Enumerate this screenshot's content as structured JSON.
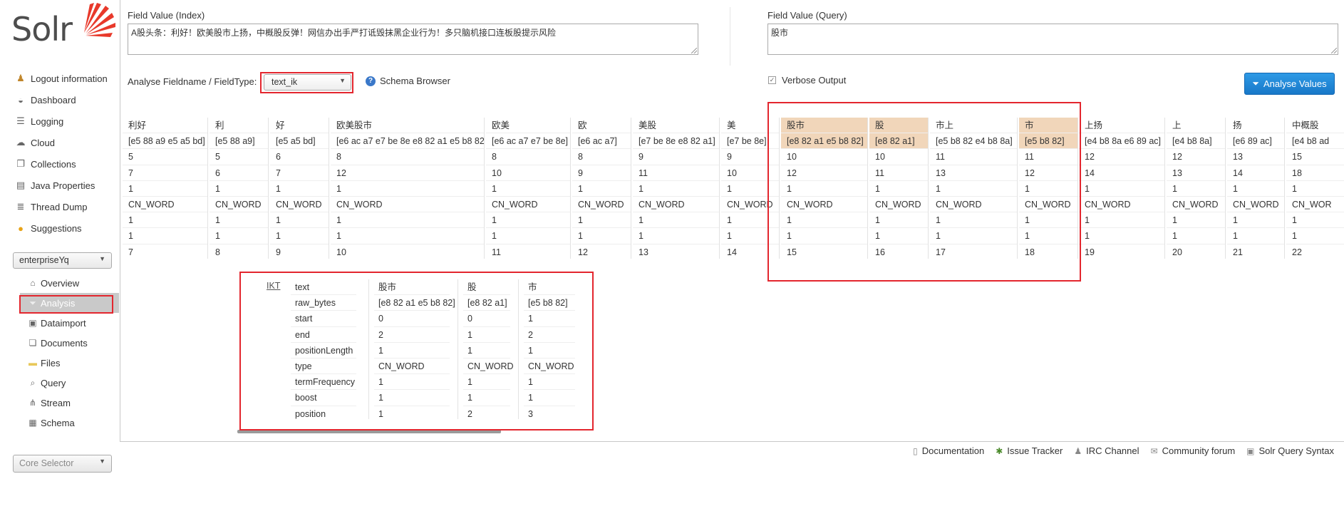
{
  "app": {
    "logo_text": "Solr"
  },
  "sidebar": {
    "items": [
      {
        "label": "Logout information",
        "icon": "user-key-icon"
      },
      {
        "label": "Dashboard",
        "icon": "dashboard-icon"
      },
      {
        "label": "Logging",
        "icon": "logging-icon"
      },
      {
        "label": "Cloud",
        "icon": "cloud-icon"
      },
      {
        "label": "Collections",
        "icon": "collections-icon"
      },
      {
        "label": "Java Properties",
        "icon": "java-properties-icon"
      },
      {
        "label": "Thread Dump",
        "icon": "thread-dump-icon"
      },
      {
        "label": "Suggestions",
        "icon": "lightbulb-icon"
      }
    ],
    "core_dropdown": "enterpriseYq",
    "core_items": [
      {
        "label": "Overview",
        "icon": "home-icon"
      },
      {
        "label": "Analysis",
        "icon": "filter-icon"
      },
      {
        "label": "Dataimport",
        "icon": "dataimport-icon"
      },
      {
        "label": "Documents",
        "icon": "documents-icon"
      },
      {
        "label": "Files",
        "icon": "folder-icon"
      },
      {
        "label": "Query",
        "icon": "search-icon"
      },
      {
        "label": "Stream",
        "icon": "stream-icon"
      },
      {
        "label": "Schema",
        "icon": "schema-icon"
      }
    ],
    "core_selector": "Core Selector"
  },
  "analysis": {
    "index_label": "Field Value (Index)",
    "index_value": "A股头条：利好！欧美股市上扬，中概股反弹！网信办出手严打诋毁抹黑企业行为！多只脑机接口连板股提示风险",
    "query_label": "Field Value (Query)",
    "query_value": "股市",
    "fieldtype_label": "Analyse Fieldname / FieldType:",
    "fieldtype_value": "text_ik",
    "schema_browser": "Schema Browser",
    "verbose_label": "Verbose Output",
    "analyse_button": "Analyse Values"
  },
  "tokens": [
    {
      "text": "利好",
      "bytes": "[e5 88 a9 e5 a5 bd]",
      "start": "5",
      "end": "7",
      "posLen": "1",
      "type": "CN_WORD",
      "tf": "1",
      "boost": "1",
      "pos": "7",
      "hl": false
    },
    {
      "text": "利",
      "bytes": "[e5 88 a9]",
      "start": "5",
      "end": "6",
      "posLen": "1",
      "type": "CN_WORD",
      "tf": "1",
      "boost": "1",
      "pos": "8",
      "hl": false
    },
    {
      "text": "好",
      "bytes": "[e5 a5 bd]",
      "start": "6",
      "end": "7",
      "posLen": "1",
      "type": "CN_WORD",
      "tf": "1",
      "boost": "1",
      "pos": "9",
      "hl": false
    },
    {
      "text": "欧美股市",
      "bytes": "[e6 ac a7 e7 be 8e e8 82 a1 e5 b8 82]",
      "start": "8",
      "end": "12",
      "posLen": "1",
      "type": "CN_WORD",
      "tf": "1",
      "boost": "1",
      "pos": "10",
      "hl": false
    },
    {
      "text": "欧美",
      "bytes": "[e6 ac a7 e7 be 8e]",
      "start": "8",
      "end": "10",
      "posLen": "1",
      "type": "CN_WORD",
      "tf": "1",
      "boost": "1",
      "pos": "11",
      "hl": false
    },
    {
      "text": "欧",
      "bytes": "[e6 ac a7]",
      "start": "8",
      "end": "9",
      "posLen": "1",
      "type": "CN_WORD",
      "tf": "1",
      "boost": "1",
      "pos": "12",
      "hl": false
    },
    {
      "text": "美股",
      "bytes": "[e7 be 8e e8 82 a1]",
      "start": "9",
      "end": "11",
      "posLen": "1",
      "type": "CN_WORD",
      "tf": "1",
      "boost": "1",
      "pos": "13",
      "hl": false
    },
    {
      "text": "美",
      "bytes": "[e7 be 8e]",
      "start": "9",
      "end": "10",
      "posLen": "1",
      "type": "CN_WORD",
      "tf": "1",
      "boost": "1",
      "pos": "14",
      "hl": false
    },
    {
      "text": "股市",
      "bytes": "[e8 82 a1 e5 b8 82]",
      "start": "10",
      "end": "12",
      "posLen": "1",
      "type": "CN_WORD",
      "tf": "1",
      "boost": "1",
      "pos": "15",
      "hl": true
    },
    {
      "text": "股",
      "bytes": "[e8 82 a1]",
      "start": "10",
      "end": "11",
      "posLen": "1",
      "type": "CN_WORD",
      "tf": "1",
      "boost": "1",
      "pos": "16",
      "hl": true
    },
    {
      "text": "市上",
      "bytes": "[e5 b8 82 e4 b8 8a]",
      "start": "11",
      "end": "13",
      "posLen": "1",
      "type": "CN_WORD",
      "tf": "1",
      "boost": "1",
      "pos": "17",
      "hl": false
    },
    {
      "text": "市",
      "bytes": "[e5 b8 82]",
      "start": "11",
      "end": "12",
      "posLen": "1",
      "type": "CN_WORD",
      "tf": "1",
      "boost": "1",
      "pos": "18",
      "hl": true
    },
    {
      "text": "上扬",
      "bytes": "[e4 b8 8a e6 89 ac]",
      "start": "12",
      "end": "14",
      "posLen": "1",
      "type": "CN_WORD",
      "tf": "1",
      "boost": "1",
      "pos": "19",
      "hl": false
    },
    {
      "text": "上",
      "bytes": "[e4 b8 8a]",
      "start": "12",
      "end": "13",
      "posLen": "1",
      "type": "CN_WORD",
      "tf": "1",
      "boost": "1",
      "pos": "20",
      "hl": false
    },
    {
      "text": "扬",
      "bytes": "[e6 89 ac]",
      "start": "13",
      "end": "14",
      "posLen": "1",
      "type": "CN_WORD",
      "tf": "1",
      "boost": "1",
      "pos": "21",
      "hl": false
    },
    {
      "text": "中概股",
      "bytes": "[e4 b8 ad",
      "start": "15",
      "end": "18",
      "posLen": "1",
      "type": "CN_WOR",
      "tf": "1",
      "boost": "1",
      "pos": "22",
      "hl": false
    }
  ],
  "ikt": {
    "tag": "IKT",
    "row_labels": [
      "text",
      "raw_bytes",
      "start",
      "end",
      "positionLength",
      "type",
      "termFrequency",
      "boost",
      "position"
    ],
    "tokens": [
      {
        "values": [
          "股市",
          "[e8 82 a1 e5 b8 82]",
          "0",
          "2",
          "1",
          "CN_WORD",
          "1",
          "1",
          "1"
        ]
      },
      {
        "values": [
          "股",
          "[e8 82 a1]",
          "0",
          "1",
          "1",
          "CN_WORD",
          "1",
          "1",
          "2"
        ]
      },
      {
        "values": [
          "市",
          "[e5 b8 82]",
          "1",
          "2",
          "1",
          "CN_WORD",
          "1",
          "1",
          "3"
        ]
      }
    ]
  },
  "footer": {
    "links": [
      {
        "label": "Documentation",
        "icon": "document-icon"
      },
      {
        "label": "Issue Tracker",
        "icon": "bug-icon"
      },
      {
        "label": "IRC Channel",
        "icon": "irc-icon"
      },
      {
        "label": "Community forum",
        "icon": "mail-icon"
      },
      {
        "label": "Solr Query Syntax",
        "icon": "query-syntax-icon"
      }
    ]
  },
  "colors": {
    "highlight": "#f1d6ba",
    "annotation_red": "#e3262e",
    "button_blue": "#1e88d8",
    "logo_orange": "#e8392b"
  }
}
